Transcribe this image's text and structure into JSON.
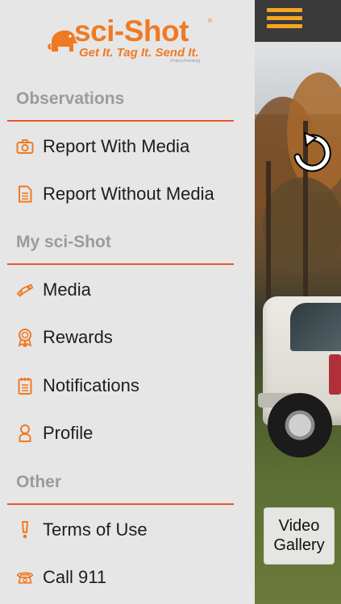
{
  "logo": {
    "title": "sci-Shot",
    "registered_mark": "®",
    "tagline": "Get It. Tag It. Send It.",
    "patent_note": "(Patent Pending)"
  },
  "menu": {
    "sections": [
      {
        "header": "Observations",
        "items": [
          {
            "label": "Report With Media",
            "icon": "camera-icon"
          },
          {
            "label": "Report Without Media",
            "icon": "document-icon"
          }
        ]
      },
      {
        "header": "My sci-Shot",
        "items": [
          {
            "label": "Media",
            "icon": "media-icon"
          },
          {
            "label": "Rewards",
            "icon": "award-ribbon-icon"
          },
          {
            "label": "Notifications",
            "icon": "notepad-icon"
          },
          {
            "label": "Profile",
            "icon": "person-icon"
          }
        ]
      },
      {
        "header": "Other",
        "items": [
          {
            "label": "Terms of Use",
            "icon": "exclamation-icon"
          },
          {
            "label": "Call 911",
            "icon": "telephone-icon"
          }
        ]
      }
    ]
  },
  "camera": {
    "video_gallery_label_line1": "Video",
    "video_gallery_label_line2": "Gallery"
  },
  "colors": {
    "accent": "#f07a24",
    "divider": "#e8562a",
    "header_text": "#9b9b9b",
    "menu_bar": "#3a3a3a",
    "hamburger": "#f5a623"
  }
}
